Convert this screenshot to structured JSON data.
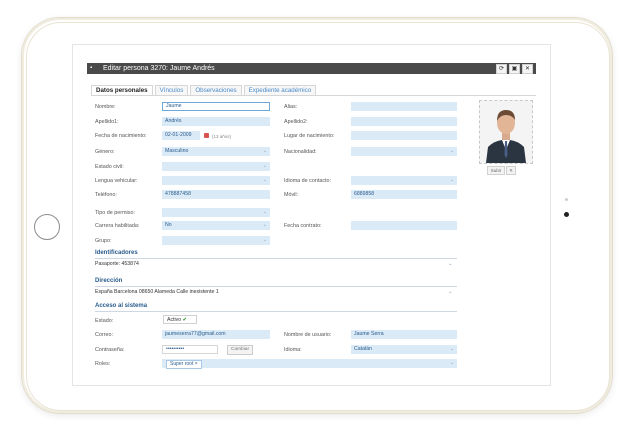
{
  "window": {
    "title": "Editar persona 3270: Jaume Andrés",
    "buttons": [
      "⟳",
      "▣",
      "✕"
    ]
  },
  "tabs": [
    {
      "label": "Datos personales",
      "active": true
    },
    {
      "label": "Vínculos",
      "active": false
    },
    {
      "label": "Observaciones",
      "active": false
    },
    {
      "label": "Expediente académico",
      "active": false
    }
  ],
  "fields": {
    "nombre": {
      "label": "Nombre:",
      "value": "Jaume"
    },
    "alias": {
      "label": "Alias:",
      "value": ""
    },
    "apellido1": {
      "label": "Apellido1:",
      "value": "Andrés"
    },
    "apellido2": {
      "label": "Apellido2:",
      "value": ""
    },
    "fecha_nac": {
      "label": "Fecha de nacimiento:",
      "value": "02-01-2009",
      "age": "(13 años)"
    },
    "lugar_nac": {
      "label": "Lugar de nacimiento:",
      "value": ""
    },
    "genero": {
      "label": "Género:",
      "value": "Masculino"
    },
    "nacionalidad": {
      "label": "Nacionalidad:",
      "value": ""
    },
    "estado_civil": {
      "label": "Estado civil:",
      "value": ""
    },
    "lengua": {
      "label": "Lengua vehicular:",
      "value": ""
    },
    "idioma_contacto": {
      "label": "Idioma de contacto:",
      "value": ""
    },
    "telefono": {
      "label": "Teléfono:",
      "value": "478887458"
    },
    "movil": {
      "label": "Móvil:",
      "value": "6889858"
    },
    "tipo_permiso": {
      "label": "Tipo de permiso:",
      "value": ""
    },
    "carrera": {
      "label": "Carrera habilitada:",
      "value": "No"
    },
    "fecha_contrato": {
      "label": "Fecha contrato:",
      "value": ""
    },
    "grupo": {
      "label": "Grupo:",
      "value": ""
    }
  },
  "photo": {
    "upload_label": "Subir",
    "remove_label": "✕"
  },
  "identificadores": {
    "title": "Identificadores",
    "value": "Pasaporte: 453874"
  },
  "direccion": {
    "title": "Dirección",
    "value": "España Barcelona 08650 Alameda Calle inexistente 1"
  },
  "acceso": {
    "title": "Acceso al sistema",
    "estado": {
      "label": "Estado:",
      "value": "Activo",
      "check": "✔"
    },
    "correo": {
      "label": "Correo:",
      "value": "jaumeserra77@gmail.com"
    },
    "usuario": {
      "label": "Nombre de usuario:",
      "value": "Jaume Serra"
    },
    "contrasena": {
      "label": "Contraseña:",
      "value": "••••••••••",
      "button": "Cambiar"
    },
    "idioma": {
      "label": "Idioma:",
      "value": "Catalán"
    },
    "roles": {
      "label": "Roles:",
      "tag": "Super root ×"
    }
  },
  "colors": {
    "titlebar": "#4a4a4a",
    "input_bg": "#dbeaf7",
    "accent": "#2a5c8c",
    "link": "#4a8bc9"
  }
}
